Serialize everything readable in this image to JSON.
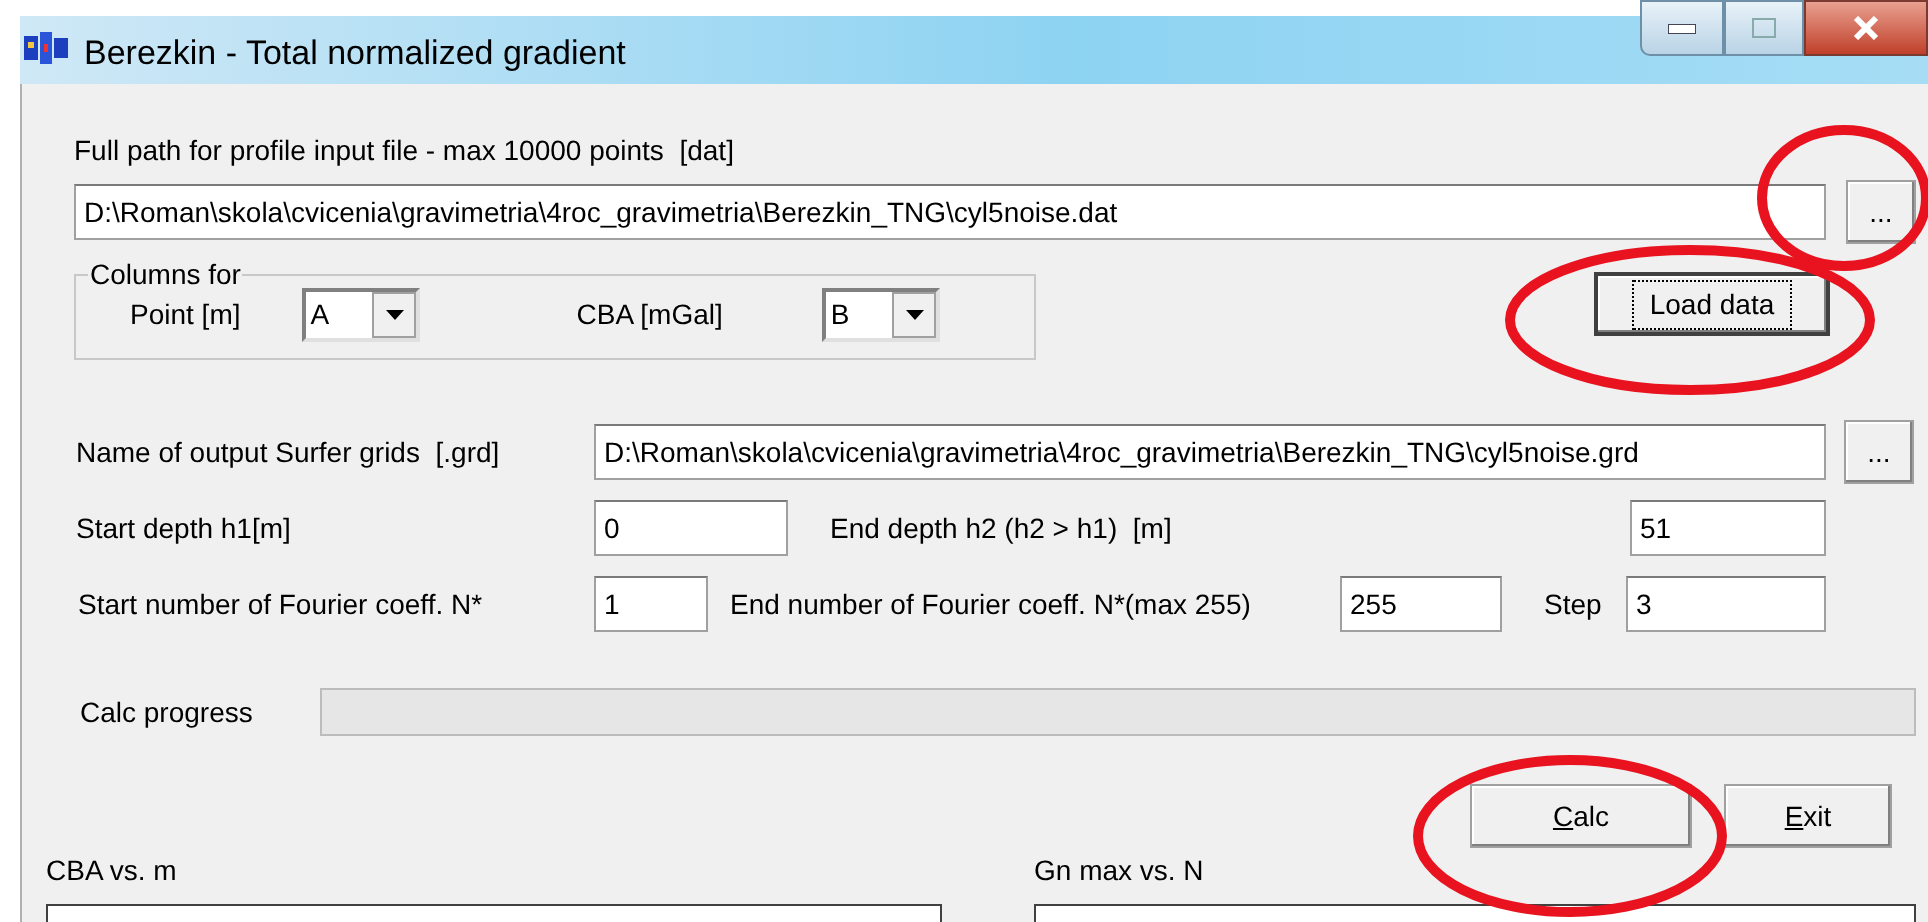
{
  "window": {
    "title": "Berezkin - Total normalized gradient"
  },
  "input_file": {
    "label": "Full path for profile input file - max 10000 points  [dat]",
    "value": "D:\\Roman\\skola\\cvicenia\\gravimetria\\4roc_gravimetria\\Berezkin_TNG\\cyl5noise.dat",
    "browse": "..."
  },
  "columns_group": {
    "legend": "Columns for",
    "point_label": "Point [m]",
    "point_value": "A",
    "cba_label": "CBA [mGal]",
    "cba_value": "B"
  },
  "load_button": {
    "label": "Load data",
    "focused": true
  },
  "output": {
    "label": "Name of output Surfer grids  [.grd]",
    "value": "D:\\Roman\\skola\\cvicenia\\gravimetria\\4roc_gravimetria\\Berezkin_TNG\\cyl5noise.grd",
    "browse": "..."
  },
  "start_depth": {
    "label": "Start depth h1[m]",
    "value": "0"
  },
  "end_depth": {
    "label": "End depth h2 (h2 > h1)  [m]",
    "value": "51"
  },
  "start_n": {
    "label": "Start number of Fourier coeff. N*",
    "value": "1"
  },
  "end_n": {
    "label": "End number of Fourier coeff. N*(max 255)",
    "value": "255"
  },
  "step": {
    "label": "Step",
    "value": "3"
  },
  "progress": {
    "label": "Calc progress",
    "level": 0
  },
  "buttons": [
    {
      "label": "Calc",
      "underline_first": true,
      "focused": false
    },
    {
      "label": "Exit",
      "underline_first": true,
      "focused": false
    }
  ],
  "charts": [
    {
      "title": "CBA vs. m"
    },
    {
      "title": "Gn max vs. N"
    }
  ]
}
